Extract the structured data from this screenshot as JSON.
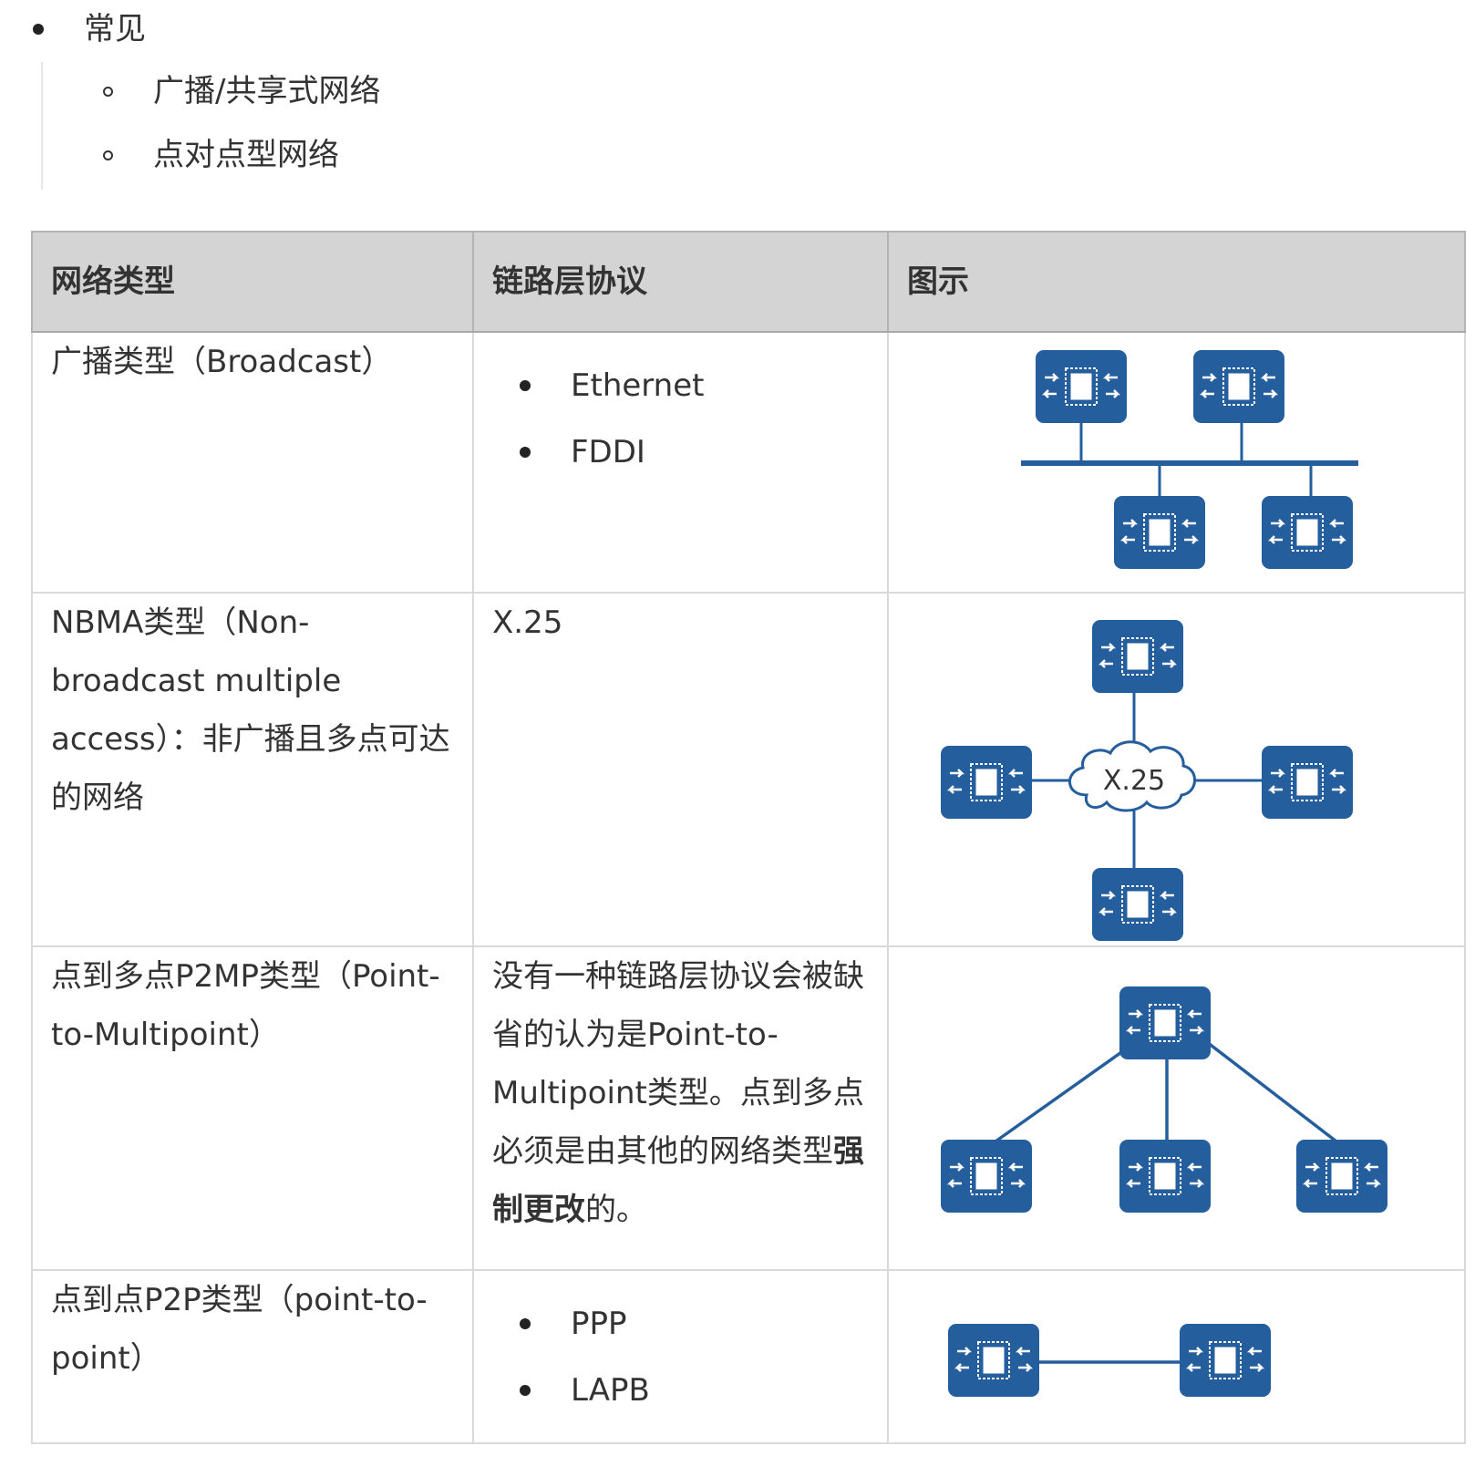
{
  "top_list": {
    "item": "常见",
    "subitems": [
      "广播/共享式网络",
      "点对点型网络"
    ]
  },
  "table": {
    "headers": [
      "网络类型",
      "链路层协议",
      "图示"
    ],
    "rows": [
      {
        "type": "广播类型（Broadcast）",
        "protocols": [
          "Ethernet",
          "FDDI"
        ]
      },
      {
        "type": "NBMA类型（Non-broadcast multiple access）：非广播且多点可达的网络",
        "protocol_text": "X.25",
        "diagram_label": "X.25"
      },
      {
        "type": "点到多点P2MP类型（Point-to-Multipoint）",
        "protocol_text_a": "没有一种链路层协议会被缺省的认为是Point-to-Multipoint类型。点到多点必须是由其他的网络类型",
        "protocol_text_bold": "强制更改",
        "protocol_text_b": "的。"
      },
      {
        "type": "点到点P2P类型（point-to-point）",
        "protocols": [
          "PPP",
          "LAPB"
        ]
      }
    ]
  },
  "colors": {
    "device_blue": "#245e9c",
    "header_bg": "#d4d4d4",
    "border": "#d9d9d9"
  },
  "icons": [
    "router-icon",
    "cloud-icon"
  ]
}
